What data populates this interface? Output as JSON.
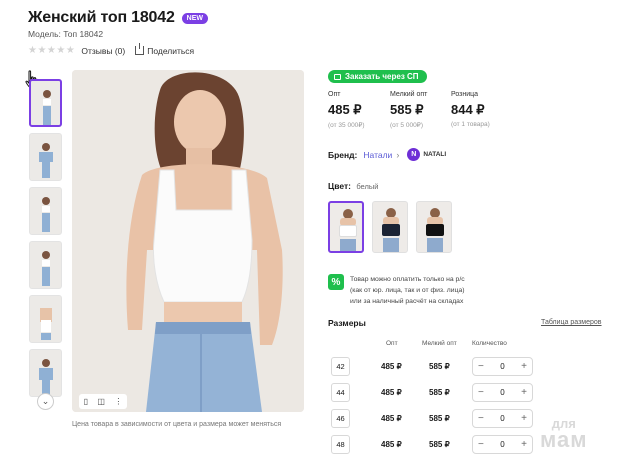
{
  "product": {
    "title": "Женский топ 18042",
    "badge": "NEW",
    "model": "Модель: Топ 18042",
    "reviews": "Отзывы (0)",
    "share": "Поделиться",
    "stars_filled": 0,
    "stars_total": 5
  },
  "gallery": {
    "thumb_count": 6,
    "tools": [
      "bookmark-icon",
      "camera-icon",
      "more-icon"
    ],
    "price_note": "Цена товара в зависимости от цвета и размера может меняться"
  },
  "purchase": {
    "sp_button": "Заказать через СП",
    "prices": [
      {
        "label": "Опт",
        "value": "485 ₽",
        "sub": "(от 35 000₽)"
      },
      {
        "label": "Мелкий опт",
        "value": "585 ₽",
        "sub": "(от 5 000₽)"
      },
      {
        "label": "Розница",
        "value": "844 ₽",
        "sub": "(от 1 товара)"
      }
    ],
    "brand_label": "Бренд:",
    "brand_link": "Натали",
    "brand_logo_letter": "N",
    "brand_logo_text": "NATALI",
    "color_label": "Цвет:",
    "color_value": "белый",
    "swatches": [
      {
        "name": "white",
        "color": "#ffffff"
      },
      {
        "name": "navy",
        "color": "#1c2333"
      },
      {
        "name": "black",
        "color": "#111111"
      }
    ],
    "pay_icon": "%",
    "pay_lines": [
      "Товар можно оплатить только на р/с",
      "(как от юр. лица, так и от физ. лица)",
      "или за наличный расчёт на складах"
    ]
  },
  "sizes": {
    "title": "Размеры",
    "table_link": "Таблица размеров",
    "headers": [
      "Опт",
      "Мелкий опт",
      "Количество"
    ],
    "rows": [
      {
        "size": "42",
        "opt": "485 ₽",
        "small_opt": "585 ₽",
        "qty": "0"
      },
      {
        "size": "44",
        "opt": "485 ₽",
        "small_opt": "585 ₽",
        "qty": "0"
      },
      {
        "size": "46",
        "opt": "485 ₽",
        "small_opt": "585 ₽",
        "qty": "0"
      },
      {
        "size": "48",
        "opt": "485 ₽",
        "small_opt": "585 ₽",
        "qty": "0"
      }
    ]
  },
  "watermark": {
    "line1": "для",
    "line2": "мам"
  },
  "colors": {
    "accent": "#7b3fe4",
    "green": "#1fbf4d",
    "link": "#5b5bd6"
  }
}
